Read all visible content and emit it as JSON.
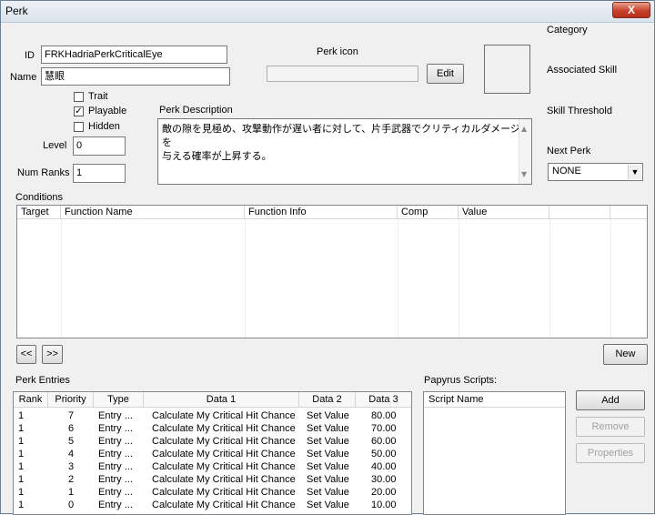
{
  "window": {
    "title": "Perk",
    "close_label": "X"
  },
  "form": {
    "id_label": "ID",
    "id_value": "FRKHadriaPerkCriticalEye",
    "name_label": "Name",
    "name_value": "慧眼",
    "perk_icon_label": "Perk icon",
    "edit_label": "Edit",
    "trait_label": "Trait",
    "playable_label": "Playable",
    "hidden_label": "Hidden",
    "level_label": "Level",
    "level_value": "0",
    "num_ranks_label": "Num Ranks",
    "num_ranks_value": "1",
    "description_label": "Perk Description",
    "description_line1": "敵の隙を見極め、攻撃動作が遅い者に対して、片手武器でクリティカルダメージを",
    "description_line2": "与える確率が上昇する。",
    "category_label": "Category",
    "associated_skill_label": "Associated Skill",
    "skill_threshold_label": "Skill Threshold",
    "next_perk_label": "Next Perk",
    "next_perk_value": "NONE"
  },
  "checkboxes": {
    "trait": false,
    "playable": true,
    "hidden": false
  },
  "conditions": {
    "label": "Conditions",
    "columns": [
      "Target",
      "Function Name",
      "Function Info",
      "Comp",
      "Value"
    ],
    "prev_label": "<<",
    "next_label": ">>",
    "new_label": "New"
  },
  "perk_entries": {
    "label": "Perk Entries",
    "columns": [
      "Rank",
      "Priority",
      "Type",
      "Data 1",
      "Data 2",
      "Data 3"
    ],
    "rows": [
      [
        "1",
        "7",
        "Entry ...",
        "Calculate My Critical Hit Chance",
        "Set Value",
        "80.00"
      ],
      [
        "1",
        "6",
        "Entry ...",
        "Calculate My Critical Hit Chance",
        "Set Value",
        "70.00"
      ],
      [
        "1",
        "5",
        "Entry ...",
        "Calculate My Critical Hit Chance",
        "Set Value",
        "60.00"
      ],
      [
        "1",
        "4",
        "Entry ...",
        "Calculate My Critical Hit Chance",
        "Set Value",
        "50.00"
      ],
      [
        "1",
        "3",
        "Entry ...",
        "Calculate My Critical Hit Chance",
        "Set Value",
        "40.00"
      ],
      [
        "1",
        "2",
        "Entry ...",
        "Calculate My Critical Hit Chance",
        "Set Value",
        "30.00"
      ],
      [
        "1",
        "1",
        "Entry ...",
        "Calculate My Critical Hit Chance",
        "Set Value",
        "20.00"
      ],
      [
        "1",
        "0",
        "Entry ...",
        "Calculate My Critical Hit Chance",
        "Set Value",
        "10.00"
      ]
    ]
  },
  "papyrus": {
    "label": "Papyrus Scripts:",
    "column": "Script Name",
    "add_label": "Add",
    "remove_label": "Remove",
    "properties_label": "Properties"
  },
  "colors": {
    "close_button": "#c7422b",
    "title_bar": "#dbe3ec"
  },
  "icons": {
    "close": "close-icon",
    "dropdown": "chevron-down-icon",
    "check": "check-icon"
  }
}
